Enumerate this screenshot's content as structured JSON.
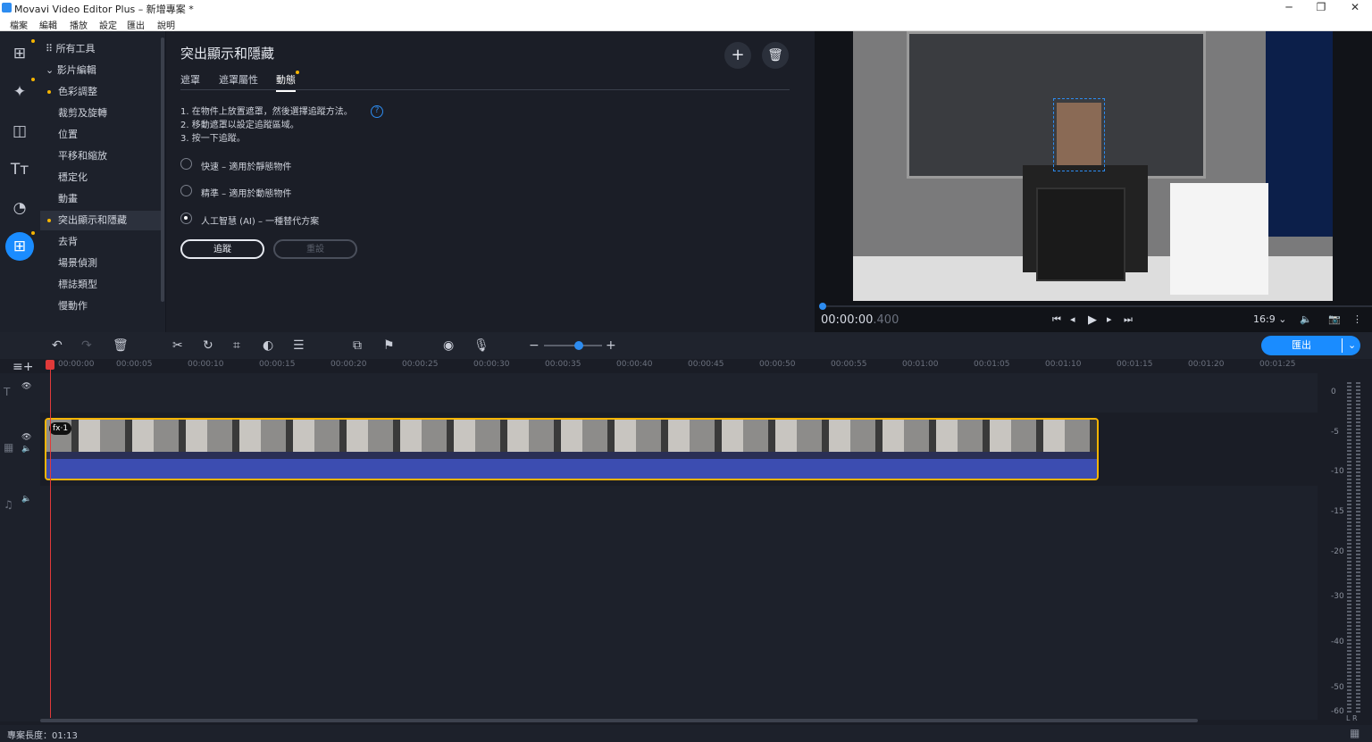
{
  "window": {
    "title": "Movavi Video Editor Plus – 新增專案 *",
    "minimize": "─",
    "maximize": "❐",
    "close": "✕"
  },
  "menu": [
    "檔案",
    "編輯",
    "播放",
    "設定",
    "匯出",
    "說明"
  ],
  "nav": {
    "icons": [
      "import-icon",
      "magic-wand-icon",
      "transitions-icon",
      "titles-icon",
      "filters-icon",
      "more-tools-icon"
    ]
  },
  "tools": {
    "all_tools": "所有工具",
    "group": "影片編輯",
    "items": [
      "色彩調整",
      "裁剪及旋轉",
      "位置",
      "平移和縮放",
      "穩定化",
      "動畫",
      "突出顯示和隱藏",
      "去背",
      "場景偵測",
      "標誌類型",
      "慢動作"
    ]
  },
  "panel": {
    "title": "突出顯示和隱藏",
    "tabs": [
      "遮罩",
      "遮罩屬性",
      "動態"
    ],
    "steps": [
      "1. 在物件上放置遮罩，然後選擇追蹤方法。",
      "2. 移動遮罩以設定追蹤區域。",
      "3. 按一下追蹤。"
    ],
    "options": [
      "快速 – 適用於靜態物件",
      "精準 – 適用於動態物件",
      "人工智慧 (AI) – 一種替代方案"
    ],
    "track_button": "追蹤",
    "reset_button": "重設"
  },
  "player": {
    "timecode": "00:00:00",
    "timecode_ms": ".400",
    "aspect": "16:9 ⌄"
  },
  "timeline": {
    "export_label": "匯出",
    "ruler": [
      "00:00:00",
      "00:00:05",
      "00:00:10",
      "00:00:15",
      "00:00:20",
      "00:00:25",
      "00:00:30",
      "00:00:35",
      "00:00:40",
      "00:00:45",
      "00:00:50",
      "00:00:55",
      "00:01:00",
      "00:01:05",
      "00:01:10",
      "00:01:15",
      "00:01:20",
      "00:01:25"
    ],
    "fx_badge": "fx·1"
  },
  "meter": [
    "0",
    "-5",
    "-10",
    "-15",
    "-20",
    "-30",
    "-40",
    "-50",
    "-60"
  ],
  "meter_channels": "L R",
  "status": {
    "length": "專案長度：01:13"
  }
}
